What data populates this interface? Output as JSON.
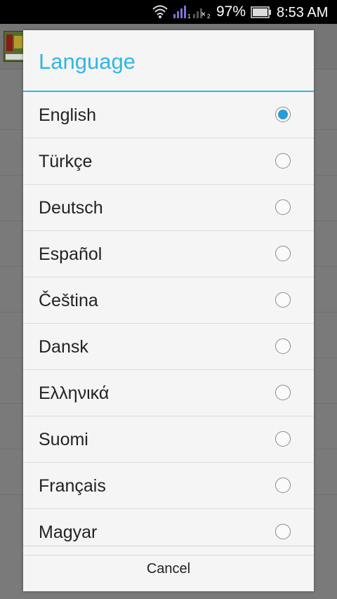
{
  "status_bar": {
    "battery_percent": "97%",
    "time": "8:53 AM",
    "signal1_sub": "1",
    "signal2_sub": "2",
    "icons": [
      "wifi-icon",
      "signal-icon",
      "no-signal-icon",
      "battery-icon"
    ]
  },
  "dialog": {
    "title": "Language",
    "accent_color": "#33b5e5",
    "items": [
      {
        "label": "English",
        "checked": true
      },
      {
        "label": "Türkçe",
        "checked": false
      },
      {
        "label": "Deutsch",
        "checked": false
      },
      {
        "label": "Español",
        "checked": false
      },
      {
        "label": "Čeština",
        "checked": false
      },
      {
        "label": "Dansk",
        "checked": false
      },
      {
        "label": "Ελληνικά",
        "checked": false
      },
      {
        "label": "Suomi",
        "checked": false
      },
      {
        "label": "Français",
        "checked": false
      },
      {
        "label": "Magyar",
        "checked": false
      }
    ],
    "cancel_label": "Cancel"
  }
}
